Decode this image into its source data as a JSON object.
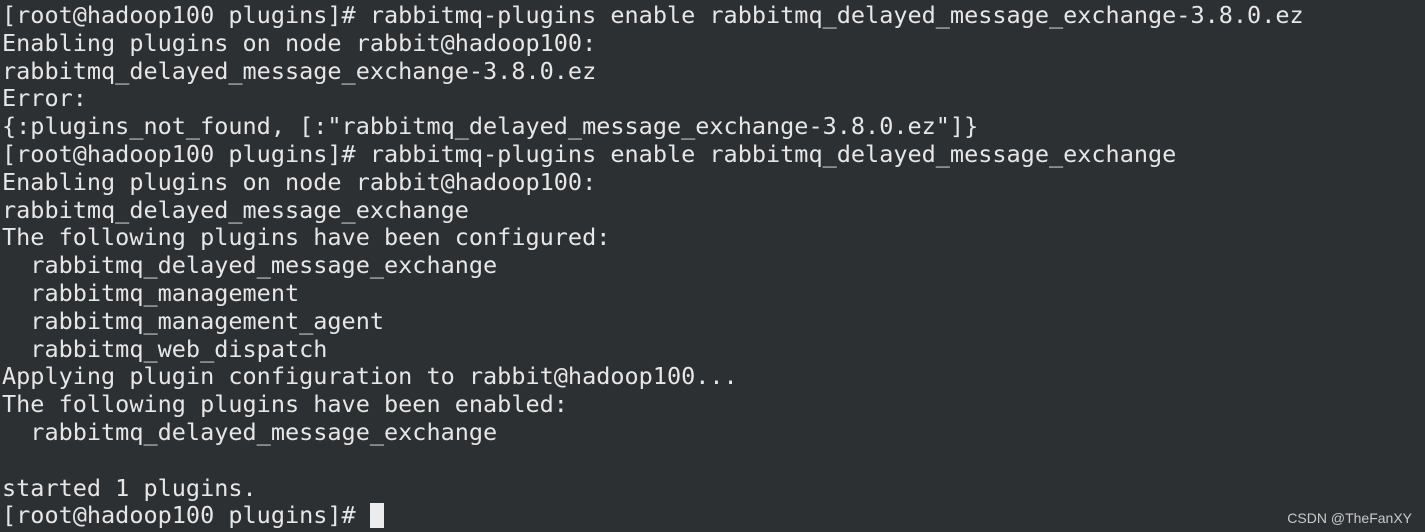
{
  "terminal": {
    "lines": [
      "[root@hadoop100 plugins]# rabbitmq-plugins enable rabbitmq_delayed_message_exchange-3.8.0.ez",
      "Enabling plugins on node rabbit@hadoop100:",
      "rabbitmq_delayed_message_exchange-3.8.0.ez",
      "Error:",
      "{:plugins_not_found, [:\"rabbitmq_delayed_message_exchange-3.8.0.ez\"]}",
      "[root@hadoop100 plugins]# rabbitmq-plugins enable rabbitmq_delayed_message_exchange",
      "Enabling plugins on node rabbit@hadoop100:",
      "rabbitmq_delayed_message_exchange",
      "The following plugins have been configured:",
      "  rabbitmq_delayed_message_exchange",
      "  rabbitmq_management",
      "  rabbitmq_management_agent",
      "  rabbitmq_web_dispatch",
      "Applying plugin configuration to rabbit@hadoop100...",
      "The following plugins have been enabled:",
      "  rabbitmq_delayed_message_exchange",
      "",
      "started 1 plugins.",
      "[root@hadoop100 plugins]# "
    ]
  },
  "watermark": "CSDN @TheFanXY",
  "colors": {
    "background": "#2d3033",
    "text": "#e6e6e6",
    "cursor": "#ececec"
  }
}
